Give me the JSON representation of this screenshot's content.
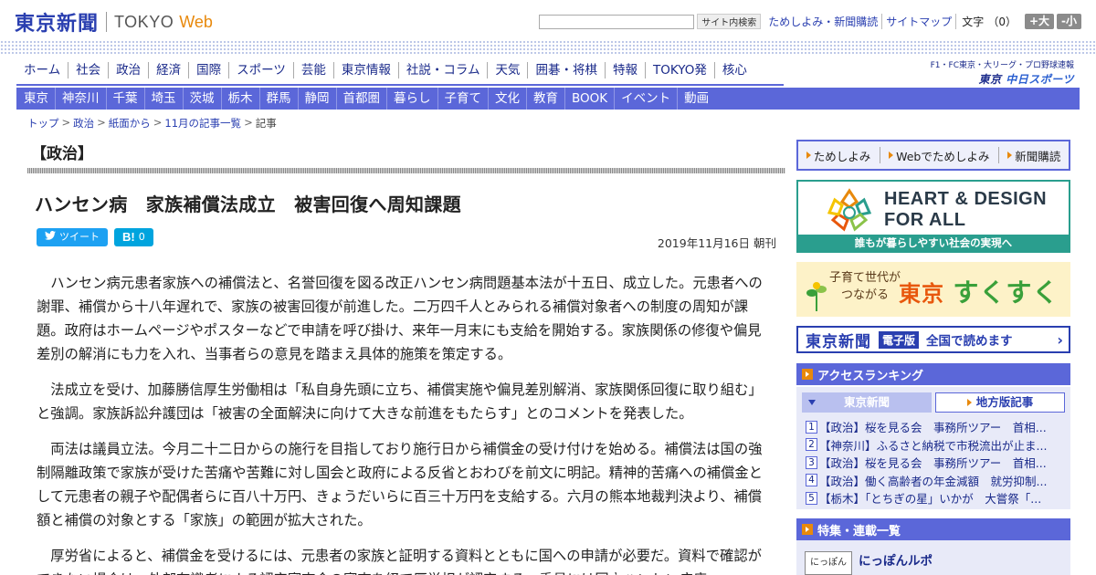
{
  "header": {
    "logo_jp": "東京新聞",
    "logo_en": "TOKYO",
    "logo_web": "Web",
    "search_placeholder": "",
    "search_button": "サイト内検索",
    "util_links": [
      "ためしよみ・新聞購読",
      "サイトマップ"
    ],
    "font_label": "文字",
    "font_count": "（0）",
    "font_plus": "+大",
    "font_minus": "-小"
  },
  "global_nav": [
    "ホーム",
    "社会",
    "政治",
    "経済",
    "国際",
    "スポーツ",
    "芸能",
    "東京情報",
    "社説・コラム",
    "天気",
    "囲碁・将棋",
    "特報",
    "TOKYO発",
    "核心"
  ],
  "chunichi": {
    "small": "F1・FC東京・大リーグ・プロ野球速報",
    "logo_a": "東京",
    "logo_b": "中日スポーツ"
  },
  "local_nav": [
    "東京",
    "神奈川",
    "千葉",
    "埼玉",
    "茨城",
    "栃木",
    "群馬",
    "静岡",
    "首都圏",
    "暮らし",
    "子育て",
    "文化",
    "教育",
    "BOOK",
    "イベント",
    "動画"
  ],
  "breadcrumb": [
    "トップ",
    "政治",
    "紙面から",
    "11月の記事一覧",
    "記事"
  ],
  "section_title": "【政治】",
  "headline": "ハンセン病　家族補償法成立　被害回復へ周知課題",
  "share": {
    "tweet": "ツイート",
    "hatena_mark": "B!",
    "hatena_count": "0"
  },
  "dateline": "2019年11月16日 朝刊",
  "article_paragraphs": [
    "ハンセン病元患者家族への補償法と、名誉回復を図る改正ハンセン病問題基本法が十五日、成立した。元患者への謝罪、補償から十八年遅れで、家族の被害回復が前進した。二万四千人とみられる補償対象者への制度の周知が課題。政府はホームページやポスターなどで申請を呼び掛け、来年一月末にも支給を開始する。家族関係の修復や偏見差別の解消にも力を入れ、当事者らの意見を踏まえ具体的施策を策定する。",
    "法成立を受け、加藤勝信厚生労働相は「私自身先頭に立ち、補償実施や偏見差別解消、家族関係回復に取り組む」と強調。家族訴訟弁護団は「被害の全面解決に向けて大きな前進をもたらす」とのコメントを発表した。",
    "両法は議員立法。今月二十二日からの施行を目指しており施行日から補償金の受け付けを始める。補償法は国の強制隔離政策で家族が受けた苦痛や苦難に対し国会と政府による反省とおわびを前文に明記。精神的苦痛への補償金として元患者の親子や配偶者らに百八十万円、きょうだいらに百三十万円を支給する。六月の熊本地裁判決より、補償額と補償の対象とする「家族」の範囲が拡大された。",
    "厚労省によると、補償金を受けるには、元患者の家族と証明する資料とともに国への申請が必要だ。資料で確認ができない場合は、外部有識者による認定審査会の審査を経て厚労相が認定する。委員には国立ハンセン病療"
  ],
  "sidebar": {
    "trial_links": [
      "ためしよみ",
      "Webでためしよみ",
      "新聞購読"
    ],
    "hd_title_1": "HEART & DESIGN",
    "hd_title_2": "FOR ALL",
    "hd_bar": "誰もが暮らしやすい社会の実現へ",
    "sk_sub_1": "子育て世代が",
    "sk_sub_2": "つながる",
    "sk_logo_a": "東京",
    "sk_logo_b": "すくすく",
    "ed_logo": "東京新聞",
    "ed_badge": "電子版",
    "ed_text": "全国で読めます",
    "ranking_title": "アクセスランキング",
    "ranking_tabs": [
      "東京新聞",
      "地方版記事"
    ],
    "ranking_items": [
      {
        "num": "1",
        "text": "【政治】桜を見る会　事務所ツアー　首相..."
      },
      {
        "num": "2",
        "text": "【神奈川】ふるさと納税で市税流出が止ま..."
      },
      {
        "num": "3",
        "text": "【政治】桜を見る会　事務所ツアー　首相..."
      },
      {
        "num": "4",
        "text": "【政治】働く高齢者の年金減額　就労抑制..."
      },
      {
        "num": "5",
        "text": "【栃木】「とちぎの星」いかが　大嘗祭「..."
      }
    ],
    "feature_title": "特集・連載一覧",
    "feature_item_title": "にっぽんルポ",
    "feature_icon_text": "にっぽん"
  },
  "colors": {
    "brand_blue": "#2a3fb0",
    "nav_blue": "#5b67d9",
    "accent_orange": "#e8890c",
    "hd_teal": "#2a9e8e"
  }
}
